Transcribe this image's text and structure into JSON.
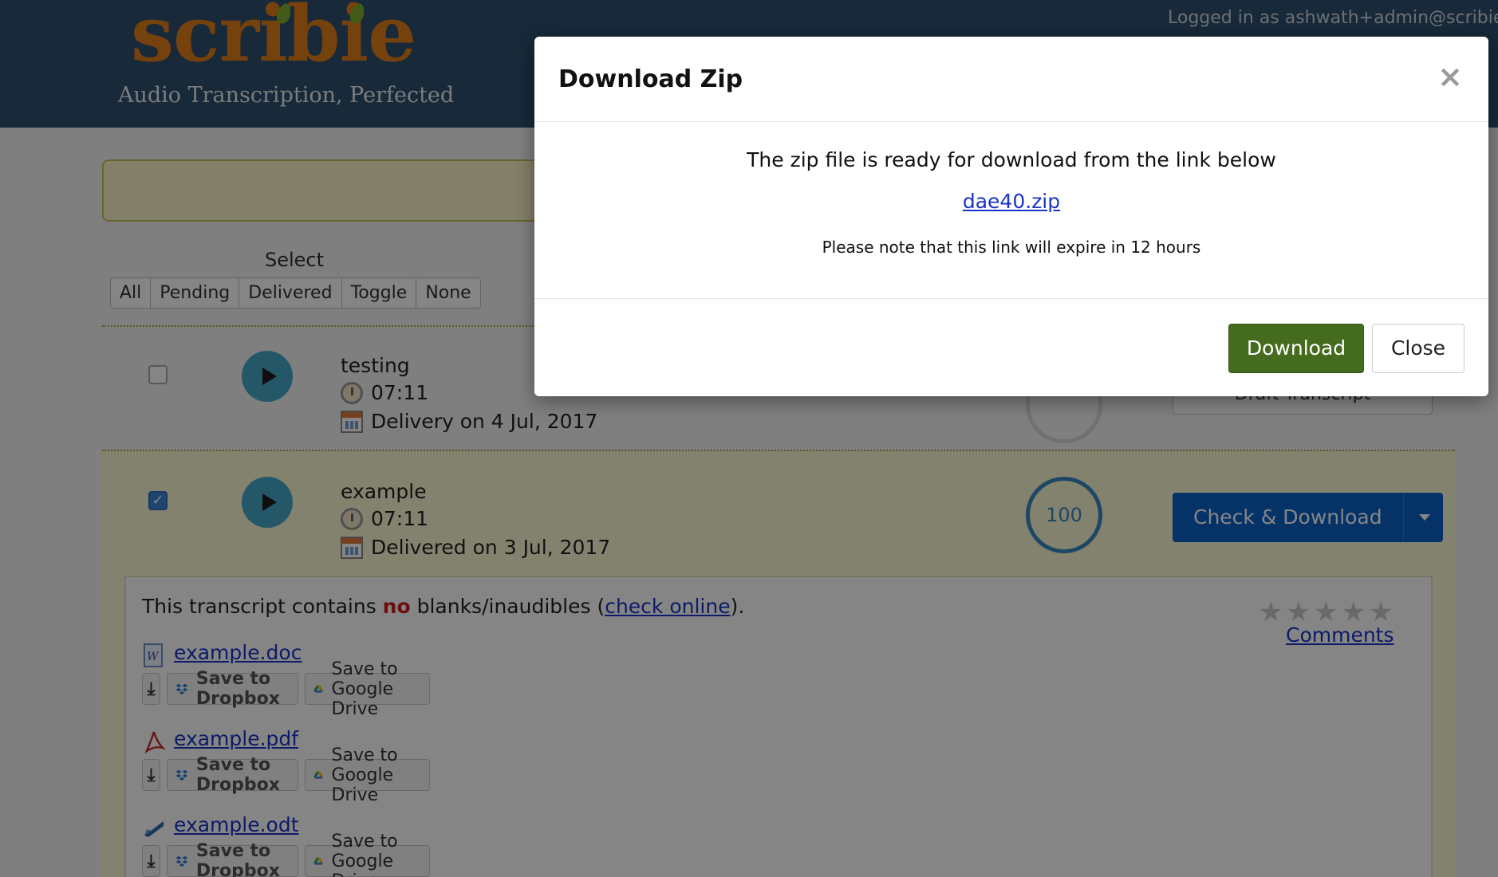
{
  "header": {
    "logo_text": "scribie",
    "tagline": "Audio Transcription, Perfected",
    "logged_in": "Logged in as ashwath+admin@scribie"
  },
  "select": {
    "title": "Select",
    "options": [
      "All",
      "Pending",
      "Delivered",
      "Toggle",
      "None"
    ]
  },
  "files": [
    {
      "name": "testing",
      "duration": "07:11",
      "delivery": "Delivery on 4 Jul, 2017",
      "checked": false,
      "action_partial": "Draft Transcript"
    },
    {
      "name": "example",
      "duration": "07:11",
      "delivery": "Delivered on 3 Jul, 2017",
      "checked": true,
      "score": "100",
      "action": "Check & Download"
    }
  ],
  "detail": {
    "pre": "This transcript contains ",
    "no": "no",
    "mid": " blanks/inaudibles (",
    "check_online": "check online",
    "post": ").",
    "comments": "Comments",
    "stars": "★★★★★",
    "files": [
      {
        "name": "example.doc",
        "icon": "word-doc-icon"
      },
      {
        "name": "example.pdf",
        "icon": "pdf-icon"
      },
      {
        "name": "example.odt",
        "icon": "odt-icon"
      }
    ],
    "dropbox_label": "Save to Dropbox",
    "drive_label": "Save to Google Drive",
    "download_glyph": "⤓"
  },
  "modal": {
    "title": "Download Zip",
    "close_glyph": "×",
    "message": "The zip file is ready for download from the link below",
    "link": "dae40.zip",
    "note": "Please note that this link will expire in 12 hours",
    "download_button": "Download",
    "close_button": "Close"
  },
  "colors": {
    "header_bg": "#2f4f6f",
    "logo_orange": "#e07e1a",
    "primary_blue": "#0b63c8",
    "download_green": "#456c1e",
    "link_blue": "#1a35c7",
    "no_red": "#d01b1b"
  }
}
